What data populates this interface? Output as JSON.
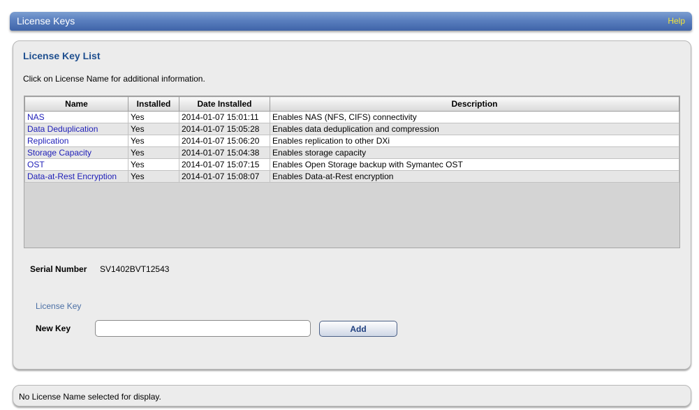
{
  "header": {
    "title": "License Keys",
    "help_label": "Help"
  },
  "license_list": {
    "heading": "License Key List",
    "hint": "Click on License Name for additional information.",
    "columns": [
      "Name",
      "Installed",
      "Date Installed",
      "Description"
    ],
    "rows": [
      {
        "name": "NAS",
        "installed": "Yes",
        "date": "2014-01-07 15:01:11",
        "description": "Enables NAS (NFS, CIFS) connectivity"
      },
      {
        "name": "Data Deduplication",
        "installed": "Yes",
        "date": "2014-01-07 15:05:28",
        "description": "Enables data deduplication and compression"
      },
      {
        "name": "Replication",
        "installed": "Yes",
        "date": "2014-01-07 15:06:20",
        "description": "Enables replication to other DXi"
      },
      {
        "name": "Storage Capacity",
        "installed": "Yes",
        "date": "2014-01-07 15:04:38",
        "description": "Enables storage capacity"
      },
      {
        "name": "OST",
        "installed": "Yes",
        "date": "2014-01-07 15:07:15",
        "description": "Enables Open Storage backup with Symantec OST"
      },
      {
        "name": "Data-at-Rest Encryption",
        "installed": "Yes",
        "date": "2014-01-07 15:08:07",
        "description": "Enables Data-at-Rest encryption"
      }
    ]
  },
  "serial": {
    "label": "Serial Number",
    "value": "SV1402BVT12543"
  },
  "license_key": {
    "section_label": "License Key",
    "new_key_label": "New Key",
    "new_key_value": "",
    "add_label": "Add"
  },
  "status": {
    "text": "No License Name selected for display."
  },
  "colors": {
    "header_blue": "#5a7fbf",
    "help_yellow": "#f3e43a",
    "heading_blue": "#1f4f8f",
    "link_blue": "#2020b8"
  }
}
